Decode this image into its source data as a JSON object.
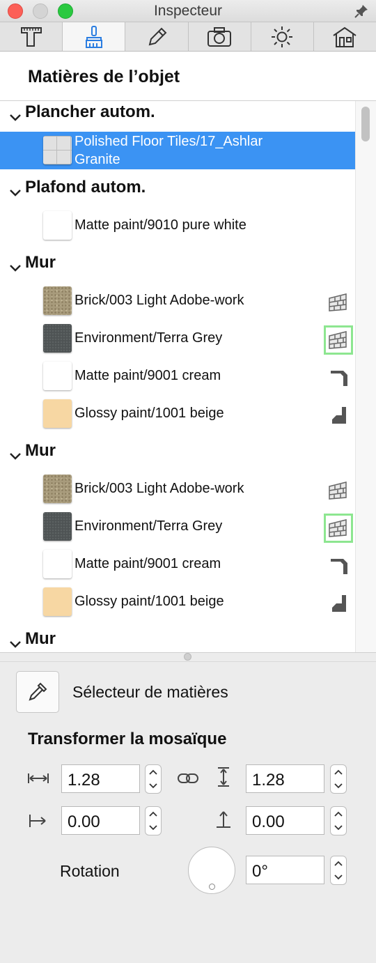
{
  "window": {
    "title": "Inspecteur"
  },
  "tabs": [
    {
      "icon": "ruler-square-icon"
    },
    {
      "icon": "paint-brush-icon"
    },
    {
      "icon": "pencil-icon"
    },
    {
      "icon": "camera-icon"
    },
    {
      "icon": "sun-icon"
    },
    {
      "icon": "house-icon"
    }
  ],
  "section_title": "Matières de l’objet",
  "groups": [
    {
      "name": "Plancher autom.",
      "items": [
        {
          "label": "Polished Floor Tiles/17_Ashlar Granite",
          "selected": true
        }
      ]
    },
    {
      "name": "Plafond autom.",
      "items": [
        {
          "label": "Matte paint/9010 pure white"
        }
      ]
    },
    {
      "name": "Mur",
      "items": [
        {
          "label": "Brick/003 Light Adobe-work",
          "icon": "brick-wall-icon"
        },
        {
          "label": "Environment/Terra Grey",
          "icon": "brick-wall-highlighted-icon"
        },
        {
          "label": "Matte paint/9001 cream",
          "icon": "wall-side-left-icon"
        },
        {
          "label": "Glossy paint/1001 beige",
          "icon": "wall-side-right-icon"
        }
      ]
    },
    {
      "name": "Mur",
      "items": [
        {
          "label": "Brick/003 Light Adobe-work",
          "icon": "brick-wall-icon"
        },
        {
          "label": "Environment/Terra Grey",
          "icon": "brick-wall-highlighted-icon"
        },
        {
          "label": "Matte paint/9001 cream",
          "icon": "wall-side-left-icon"
        },
        {
          "label": "Glossy paint/1001 beige",
          "icon": "wall-side-right-icon"
        }
      ]
    },
    {
      "name": "Mur",
      "items": []
    }
  ],
  "picker": {
    "label": "Sélecteur de matières",
    "icon": "eyedropper-icon"
  },
  "tiling": {
    "title": "Transformer la mosaïque",
    "width": "1.28",
    "height": "1.28",
    "offset_x": "0.00",
    "offset_y": "0.00",
    "rotation_label": "Rotation",
    "rotation": "0°"
  },
  "colors": {
    "selection": "#3b93f3",
    "highlight": "#8de690",
    "close": "#fc5f57",
    "zoom": "#2ac940"
  }
}
